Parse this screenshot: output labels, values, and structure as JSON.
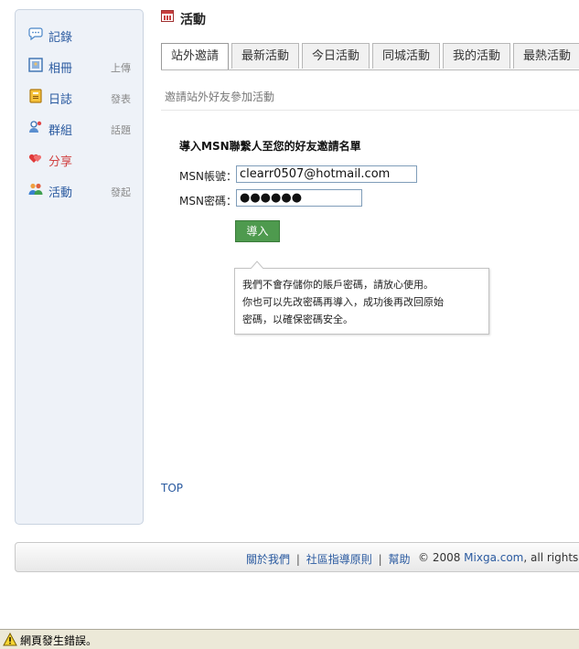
{
  "sidebar": {
    "items": [
      {
        "label": "記錄",
        "icon": "speech-bubble-icon"
      },
      {
        "label": "相冊",
        "sub": "上傳",
        "icon": "photo-icon"
      },
      {
        "label": "日誌",
        "sub": "發表",
        "icon": "notebook-icon"
      },
      {
        "label": "群組",
        "sub": "話題",
        "icon": "group-icon"
      },
      {
        "label": "分享",
        "icon": "hearts-icon"
      },
      {
        "label": "活動",
        "sub": "發起",
        "icon": "people-icon"
      }
    ]
  },
  "page": {
    "title": "活動",
    "title_icon": "calendar-icon"
  },
  "tabs": [
    {
      "label": "站外邀請",
      "active": true
    },
    {
      "label": "最新活動"
    },
    {
      "label": "今日活動"
    },
    {
      "label": "同城活動"
    },
    {
      "label": "我的活動"
    },
    {
      "label": "最熱活動"
    }
  ],
  "breadcrumb": "邀請站外好友參加活動",
  "form": {
    "heading": "導入MSN聯繫人至您的好友邀請名單",
    "account_label": "MSN帳號：",
    "account_value": "clearr0507@hotmail.com",
    "password_label": "MSN密碼：",
    "password_value": "●●●●●●",
    "import_button": "導入"
  },
  "tip": {
    "line1": "我們不會存儲你的賬戶密碼，請放心使用。",
    "line2": "你也可以先改密碼再導入，成功後再改回原始",
    "line3": "密碼，以確保密碼安全。"
  },
  "top_link": "TOP",
  "footer": {
    "about": "關於我們",
    "guidelines": "社區指導原則",
    "help": "幫助",
    "sep": "|",
    "copyright_prefix": "© 2008 ",
    "brand": "Mixga.com",
    "copyright_suffix": ", all rights"
  },
  "statusbar": {
    "text": "網頁發生錯誤。",
    "icon": "warning-icon"
  },
  "colors": {
    "link": "#2a5aa0",
    "button": "#4e9a4e",
    "sidebar_bg": "#eef2f8"
  }
}
